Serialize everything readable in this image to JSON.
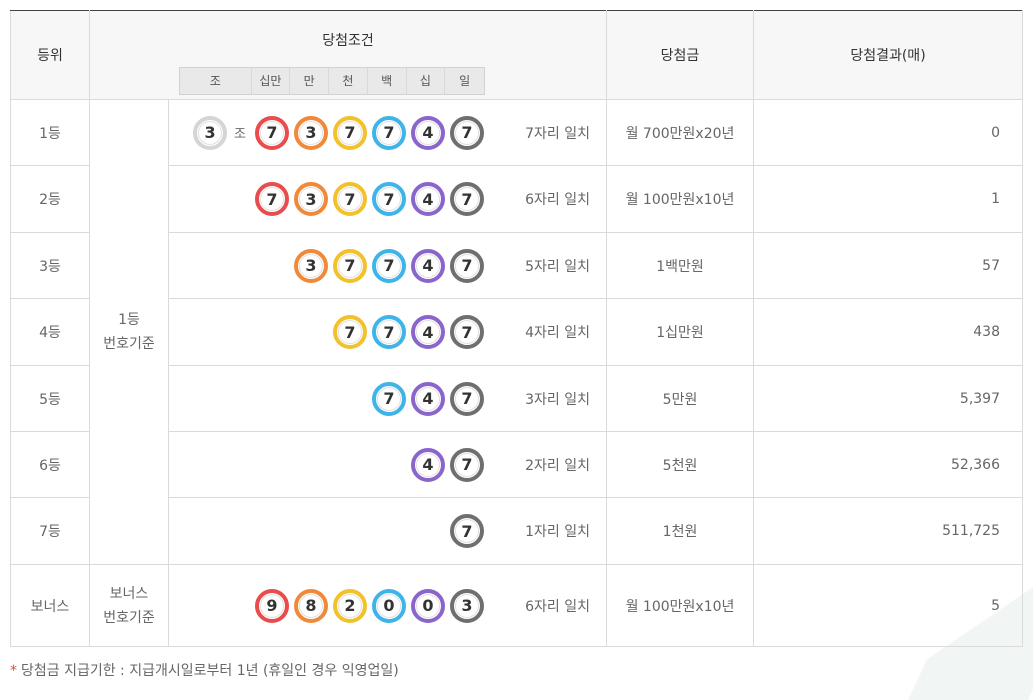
{
  "header": {
    "rank": "등위",
    "condition": "당첨조건",
    "prize": "당첨금",
    "result": "당첨결과(매)",
    "places": [
      "조",
      "십만",
      "만",
      "천",
      "백",
      "십",
      "일"
    ]
  },
  "rows": [
    {
      "rank": "1등",
      "match": "7자리 일치",
      "prize": "월 700만원x20년",
      "count": "0",
      "jo": {
        "digit": "3",
        "label": "조"
      },
      "digits": [
        "7",
        "3",
        "7",
        "7",
        "4",
        "7"
      ]
    },
    {
      "rank": "2등",
      "match": "6자리 일치",
      "prize": "월 100만원x10년",
      "count": "1",
      "digits": [
        "7",
        "3",
        "7",
        "7",
        "4",
        "7"
      ]
    },
    {
      "rank": "3등",
      "match": "5자리 일치",
      "prize": "1백만원",
      "count": "57",
      "digits": [
        "3",
        "7",
        "7",
        "4",
        "7"
      ]
    },
    {
      "rank": "4등",
      "match": "4자리 일치",
      "prize": "1십만원",
      "count": "438",
      "digits": [
        "7",
        "7",
        "4",
        "7"
      ]
    },
    {
      "rank": "5등",
      "match": "3자리 일치",
      "prize": "5만원",
      "count": "5,397",
      "digits": [
        "7",
        "4",
        "7"
      ]
    },
    {
      "rank": "6등",
      "match": "2자리 일치",
      "prize": "5천원",
      "count": "52,366",
      "digits": [
        "4",
        "7"
      ]
    },
    {
      "rank": "7등",
      "match": "1자리 일치",
      "prize": "1천원",
      "count": "511,725",
      "digits": [
        "7"
      ]
    },
    {
      "rank": "보너스",
      "match": "6자리 일치",
      "prize": "월 100만원x10년",
      "count": "5",
      "digits": [
        "9",
        "8",
        "2",
        "0",
        "0",
        "3"
      ]
    }
  ],
  "basis": {
    "main_line1": "1등",
    "main_line2": "번호기준",
    "bonus_line1": "보너스",
    "bonus_line2": "번호기준"
  },
  "footnote": {
    "star": "*",
    "text": "당첨금 지급기한 : 지급개시일로부터 1년 (휴일인 경우 익영업일)"
  },
  "colors": {
    "ball_red": "#e84c4c",
    "ball_orange": "#f08a3a",
    "ball_yellow": "#f2c12b",
    "ball_blue": "#3eb4e8",
    "ball_purple": "#8a65cc",
    "ball_dark": "#6f6f6f",
    "ball_jo": "#d5d5d5",
    "prize_text": "#c24a35"
  }
}
